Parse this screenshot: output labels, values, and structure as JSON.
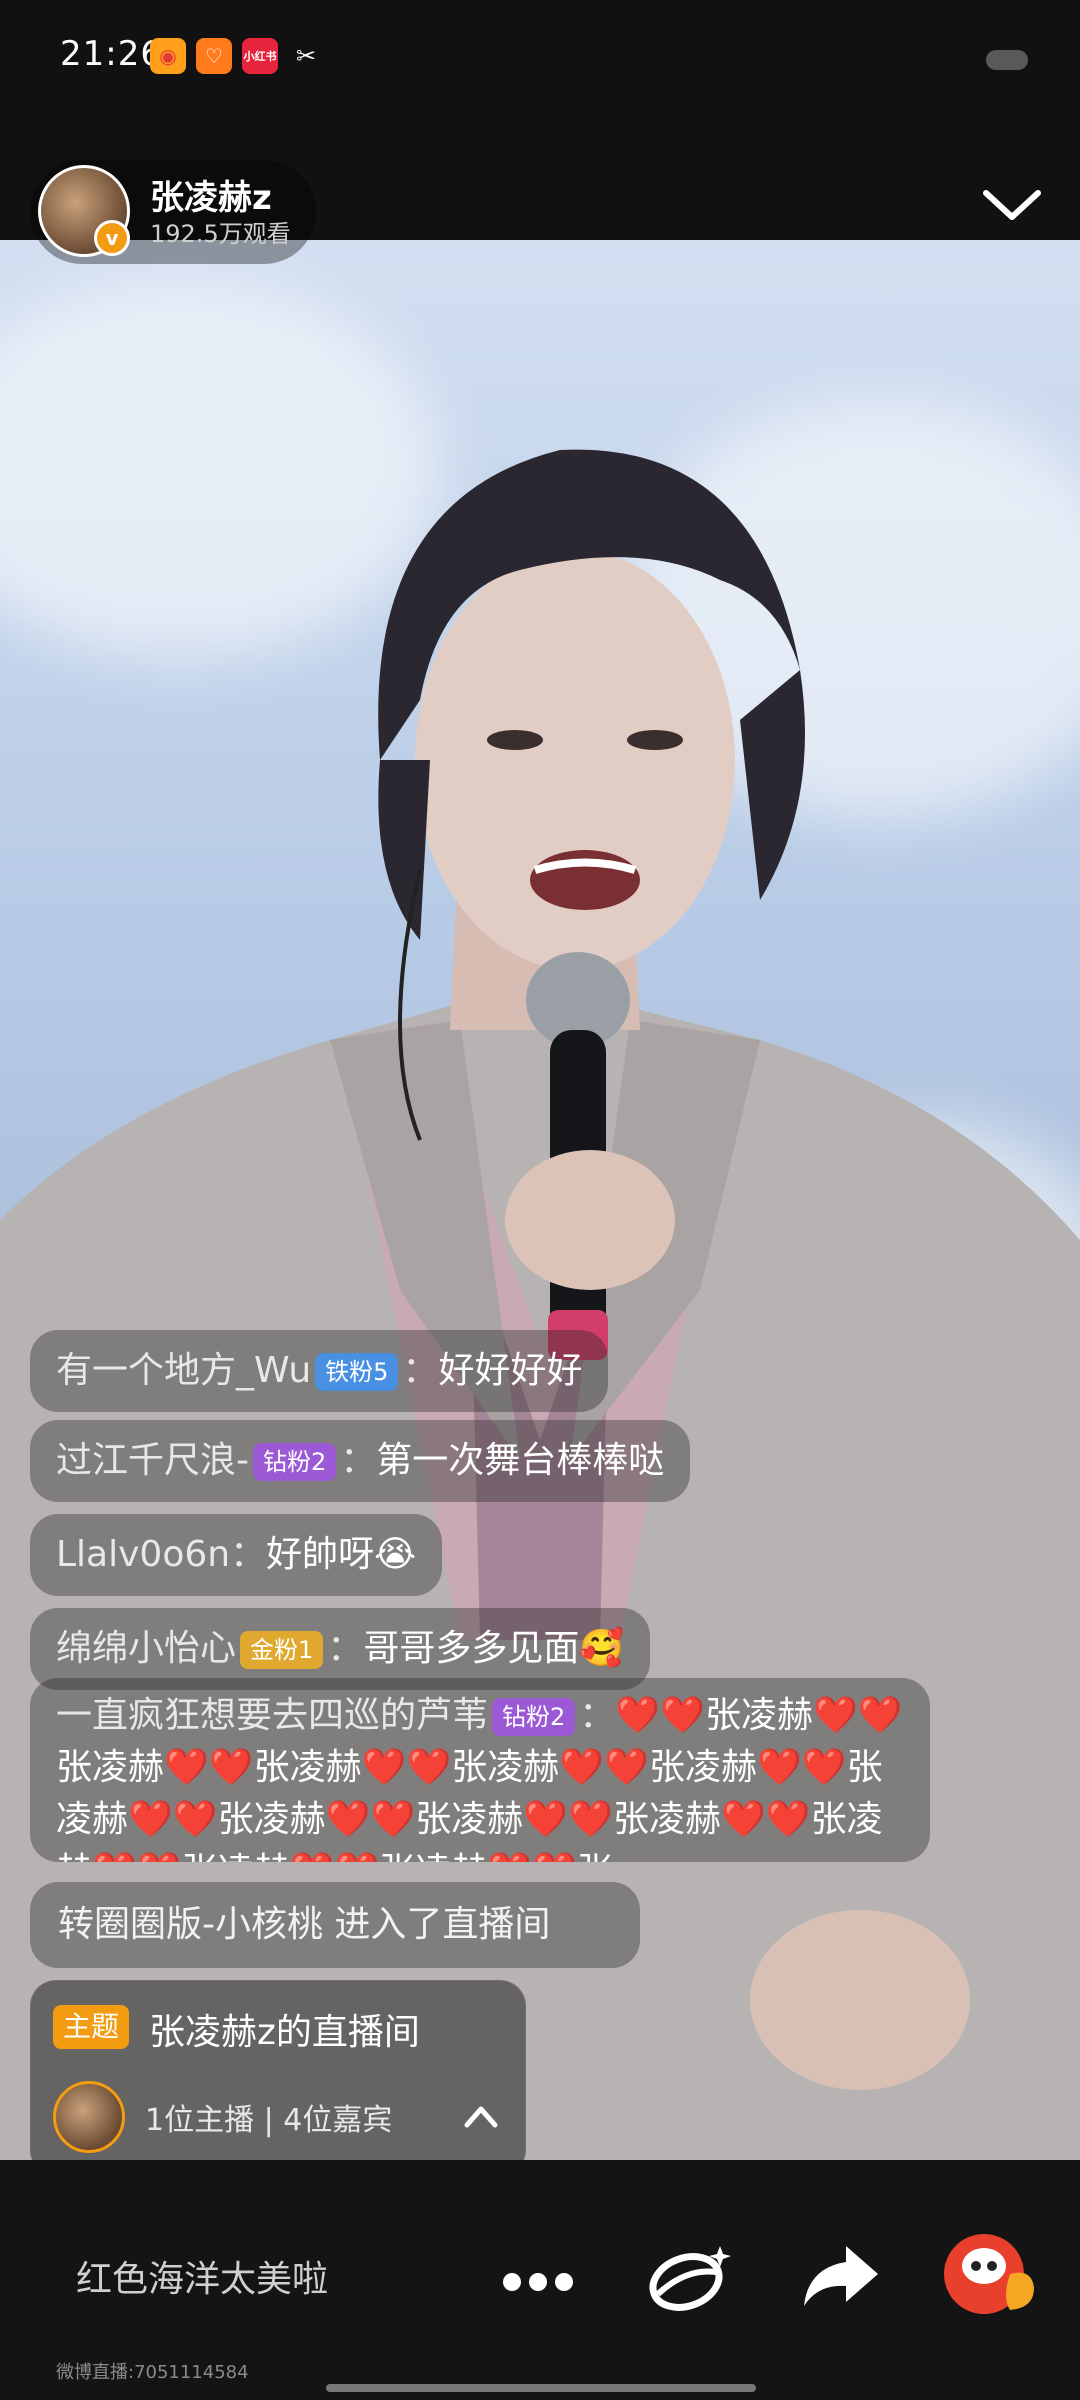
{
  "status_bar": {
    "time": "21:26",
    "apps": [
      "weibo-icon",
      "orange-app-icon",
      "xiaohongshu-icon",
      "capcut-icon"
    ],
    "xhs_label": "小红书"
  },
  "host": {
    "name": "张凌赫z",
    "viewers": "192.5万观看",
    "verified_icon": "v-badge-icon"
  },
  "comments": [
    {
      "user": "有一个地方_Wu",
      "badge": "铁粉5",
      "badge_type": "iron",
      "sep": "：",
      "text": "好好好好"
    },
    {
      "user": "过江千尺浪-",
      "badge": "钻粉2",
      "badge_type": "diamond",
      "sep": "：",
      "text": "第一次舞台棒棒哒"
    },
    {
      "user": "Llalv0o6n",
      "badge": "",
      "badge_type": "",
      "sep": "：",
      "text": "好帥呀😭"
    },
    {
      "user": "绵绵小怡心",
      "badge": "金粉1",
      "badge_type": "gold",
      "sep": "：",
      "text": "哥哥多多见面🥰"
    }
  ],
  "long_comment": {
    "user": "一直疯狂想要去四巡的芦苇",
    "badge": "钻粉2",
    "sep": "：",
    "text": "❤️❤️张凌赫❤️❤️张凌赫❤️❤️张凌赫❤️❤️张凌赫❤️❤️张凌赫❤️❤️张凌赫❤️❤️张凌赫❤️❤️张凌赫❤️❤️张凌赫❤️❤️张凌赫❤️❤️张凌赫❤️❤️张凌赫❤️❤️张"
  },
  "enter_message": "转圈圈版-小核桃 进入了直播间",
  "room": {
    "tag": "主题",
    "title": "张凌赫z的直播间",
    "stats": "1位主播 | 4位嘉宾"
  },
  "bottom": {
    "input_placeholder": "红色海洋太美啦",
    "room_id": "微博直播:7051114584"
  },
  "colors": {
    "accent": "#f39c12",
    "like": "#e8402c",
    "heart": "#e02020"
  }
}
